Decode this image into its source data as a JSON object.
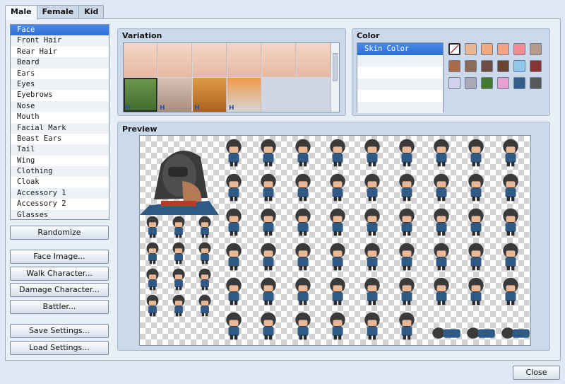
{
  "tabs": [
    "Male",
    "Female",
    "Kid"
  ],
  "parts": [
    "Face",
    "Front Hair",
    "Rear Hair",
    "Beard",
    "Ears",
    "Eyes",
    "Eyebrows",
    "Nose",
    "Mouth",
    "Facial Mark",
    "Beast Ears",
    "Tail",
    "Wing",
    "Clothing",
    "Cloak",
    "Accessory 1",
    "Accessory 2",
    "Glasses"
  ],
  "buttons": {
    "randomize": "Randomize",
    "face_image": "Face Image...",
    "walk_character": "Walk Character...",
    "damage_character": "Damage Character...",
    "battler": "Battler...",
    "save_settings": "Save Settings...",
    "load_settings": "Load Settings...",
    "close": "Close"
  },
  "variation": {
    "title": "Variation",
    "badge": "H"
  },
  "color": {
    "title": "Color",
    "selected_item": "Skin Color",
    "swatches": [
      "#ffffff",
      "#e9b593",
      "#f1a97d",
      "#f4a482",
      "#f18a93",
      "#b69a8c",
      "#a86a48",
      "#8e6a58",
      "#6c4e44",
      "#6a4532",
      "#8fc8ea",
      "#8b3434",
      "#d2d2ec",
      "#a9a9b9",
      "#43792d",
      "#e8a0d4",
      "#345f8a",
      "#585858"
    ]
  },
  "preview": {
    "title": "Preview"
  }
}
